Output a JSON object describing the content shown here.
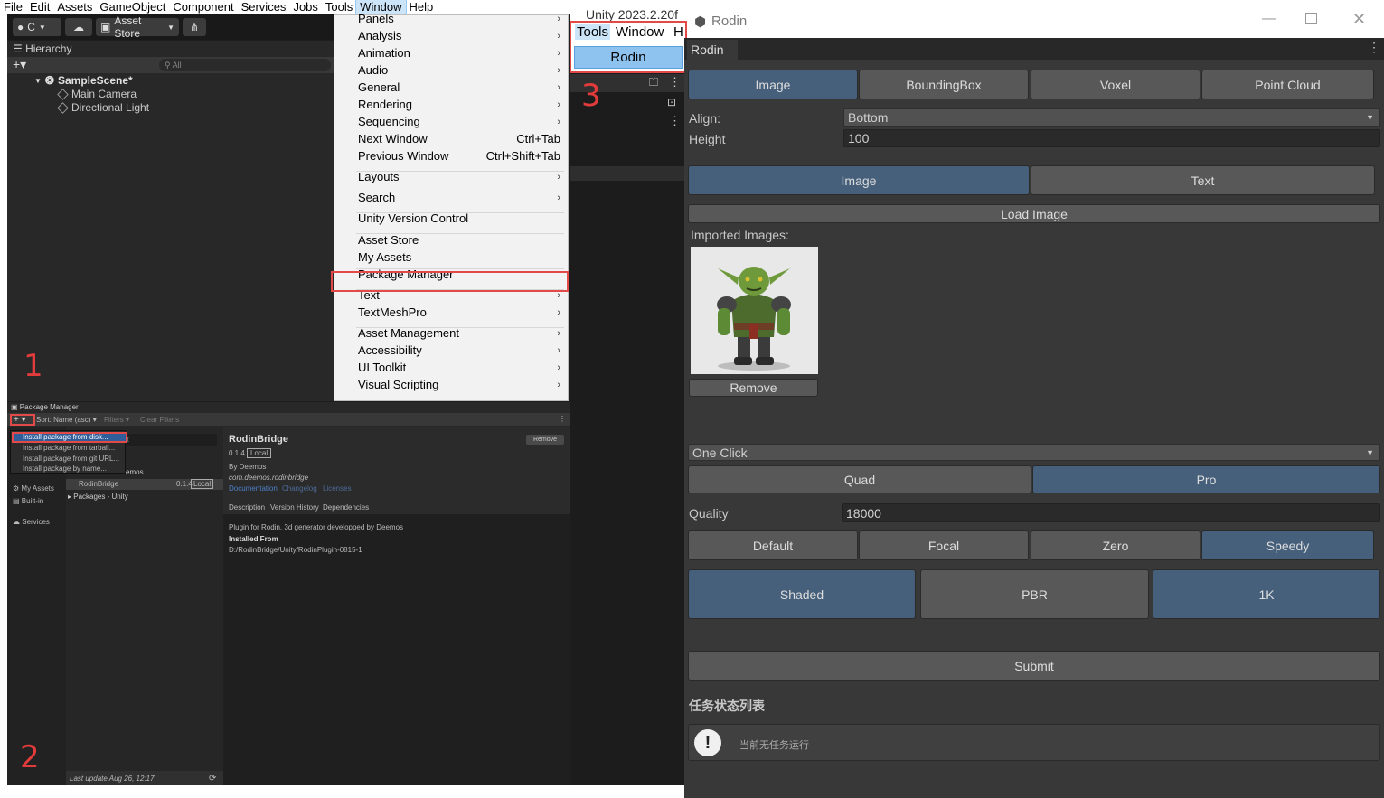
{
  "menubar": [
    "File",
    "Edit",
    "Assets",
    "GameObject",
    "Component",
    "Services",
    "Jobs",
    "Tools",
    "Window",
    "Help"
  ],
  "menubar_active": "Window",
  "toolbar": {
    "account": "C",
    "asset_store": "Asset Store"
  },
  "hierarchy": {
    "tab": "Hierarchy",
    "search_placeholder": "All",
    "scene": "SampleScene*",
    "objects": [
      "Main Camera",
      "Directional Light"
    ]
  },
  "window_menu": [
    {
      "label": "Panels",
      "shortcut": "",
      "sub": true
    },
    {
      "label": "Analysis",
      "shortcut": "",
      "sub": true
    },
    {
      "label": "Animation",
      "shortcut": "",
      "sub": true
    },
    {
      "label": "Audio",
      "shortcut": "",
      "sub": true
    },
    {
      "label": "General",
      "shortcut": "",
      "sub": true
    },
    {
      "label": "Rendering",
      "shortcut": "",
      "sub": true
    },
    {
      "label": "Sequencing",
      "shortcut": "",
      "sub": true
    },
    {
      "label": "Next Window",
      "shortcut": "Ctrl+Tab",
      "sub": false
    },
    {
      "label": "Previous Window",
      "shortcut": "Ctrl+Shift+Tab",
      "sub": false
    },
    {
      "label": "Layouts",
      "shortcut": "",
      "sub": true
    },
    {
      "label": "Search",
      "shortcut": "",
      "sub": true
    },
    {
      "label": "Unity Version Control",
      "shortcut": "",
      "sub": false
    },
    {
      "label": "Asset Store",
      "shortcut": "",
      "sub": false
    },
    {
      "label": "My Assets",
      "shortcut": "",
      "sub": false
    },
    {
      "label": "Package Manager",
      "shortcut": "",
      "sub": false
    },
    {
      "label": "Text",
      "shortcut": "",
      "sub": true
    },
    {
      "label": "TextMeshPro",
      "shortcut": "",
      "sub": true
    },
    {
      "label": "Asset Management",
      "shortcut": "",
      "sub": true
    },
    {
      "label": "Accessibility",
      "shortcut": "",
      "sub": true
    },
    {
      "label": "UI Toolkit",
      "shortcut": "",
      "sub": true
    },
    {
      "label": "Visual Scripting",
      "shortcut": "",
      "sub": true
    }
  ],
  "steps": [
    "1",
    "2",
    "3"
  ],
  "package_manager": {
    "title": "Package Manager",
    "sort": "Sort: Name (asc)",
    "filters": "Filters",
    "clear_filters": "Clear Filters",
    "add_menu": [
      "Install package from disk...",
      "Install package from tarball...",
      "Install package from git URL...",
      "Install package by name..."
    ],
    "search_partial": "ect",
    "group_partial": "emos",
    "side_items": [
      "My Assets",
      "Built-in",
      "Services"
    ],
    "package_row": {
      "name": "RodinBridge",
      "version": "0.1.4",
      "tag": "Local"
    },
    "packages_unity": "Packages - Unity",
    "last_update": "Last update Aug 26, 12:17",
    "detail": {
      "name": "RodinBridge",
      "version": "0.1.4",
      "tag": "Local",
      "remove": "Remove",
      "by": "By Deemos",
      "id": "com.deemos.rodinbridge",
      "links": [
        "Documentation",
        "Changelog",
        "Licenses"
      ],
      "tabs": [
        "Description",
        "Version History",
        "Dependencies"
      ],
      "description": "Plugin for Rodin, 3d generator developped by Deemos",
      "installed_from_label": "Installed From",
      "installed_from": "D:/RodinBridge/Unity/RodinPlugin-0815-1"
    }
  },
  "tools_menu": {
    "items": [
      "Tools",
      "Window",
      "H"
    ],
    "rodin": "Rodin",
    "title_partial": "Unity 2023.2.20f"
  },
  "rodin": {
    "window_title": "Rodin",
    "tab": "Rodin",
    "mode_tabs": [
      "Image",
      "BoundingBox",
      "Voxel",
      "Point Cloud"
    ],
    "mode_active": "Image",
    "align_label": "Align:",
    "align_value": "Bottom",
    "height_label": "Height",
    "height_value": "100",
    "input_tabs": [
      "Image",
      "Text"
    ],
    "input_active": "Image",
    "load_image": "Load Image",
    "imported_label": "Imported Images:",
    "remove": "Remove",
    "generate_mode": "One Click",
    "tier_tabs": [
      "Quad",
      "Pro"
    ],
    "tier_active": "Pro",
    "quality_label": "Quality",
    "quality_value": "18000",
    "speed_tabs": [
      "Default",
      "Focal",
      "Zero",
      "Speedy"
    ],
    "speed_active": "Speedy",
    "material_tabs": [
      "Shaded",
      "PBR",
      "1K"
    ],
    "material_active": [
      "Shaded",
      "1K"
    ],
    "submit": "Submit",
    "task_header": "任务状态列表",
    "task_empty": "当前无任务运行"
  },
  "colors": {
    "accent_tab": "#46607c",
    "highlight": "#e24a4a",
    "menu_select": "#8ec3ef"
  }
}
